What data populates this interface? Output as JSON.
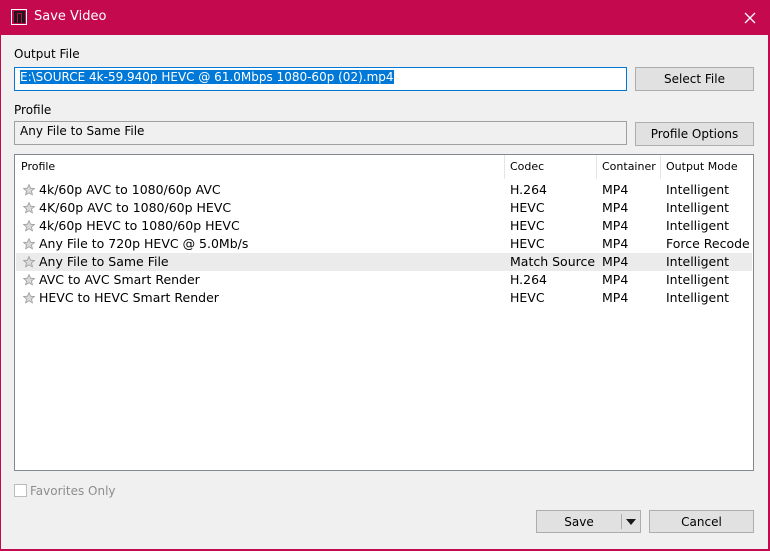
{
  "window": {
    "title": "Save Video"
  },
  "colors": {
    "titlebar": "#c4094f",
    "selection": "#0078d7"
  },
  "output_file": {
    "label": "Output File",
    "value": "E:\\SOURCE 4k-59.940p HEVC @ 61.0Mbps 1080-60p (02).mp4",
    "select_button": "Select File"
  },
  "profile": {
    "label": "Profile",
    "value": "Any File to Same File",
    "options_button": "Profile Options"
  },
  "table": {
    "columns": [
      "Profile",
      "Codec",
      "Container",
      "Output Mode"
    ],
    "rows": [
      {
        "profile": "4k/60p AVC to 1080/60p AVC",
        "codec": "H.264",
        "container": "MP4",
        "mode": "Intelligent",
        "icon": "star-icon"
      },
      {
        "profile": "4K/60p AVC to 1080/60p HEVC",
        "codec": "HEVC",
        "container": "MP4",
        "mode": "Intelligent",
        "icon": "star-icon"
      },
      {
        "profile": "4k/60p HEVC to 1080/60p HEVC",
        "codec": "HEVC",
        "container": "MP4",
        "mode": "Intelligent",
        "icon": "star-icon"
      },
      {
        "profile": "Any File to 720p HEVC @ 5.0Mb/s",
        "codec": "HEVC",
        "container": "MP4",
        "mode": "Force Recode",
        "icon": "star-icon"
      },
      {
        "profile": "Any File to Same File",
        "codec": "Match Source",
        "container": "MP4",
        "mode": "Intelligent",
        "icon": "star-icon",
        "selected": true
      },
      {
        "profile": "AVC to AVC Smart Render",
        "codec": "H.264",
        "container": "MP4",
        "mode": "Intelligent",
        "icon": "star-icon"
      },
      {
        "profile": "HEVC to HEVC Smart Render",
        "codec": "HEVC",
        "container": "MP4",
        "mode": "Intelligent",
        "icon": "star-icon"
      }
    ]
  },
  "favorites": {
    "label": "Favorites Only",
    "checked": false
  },
  "footer": {
    "save_label": "Save",
    "cancel_label": "Cancel"
  }
}
